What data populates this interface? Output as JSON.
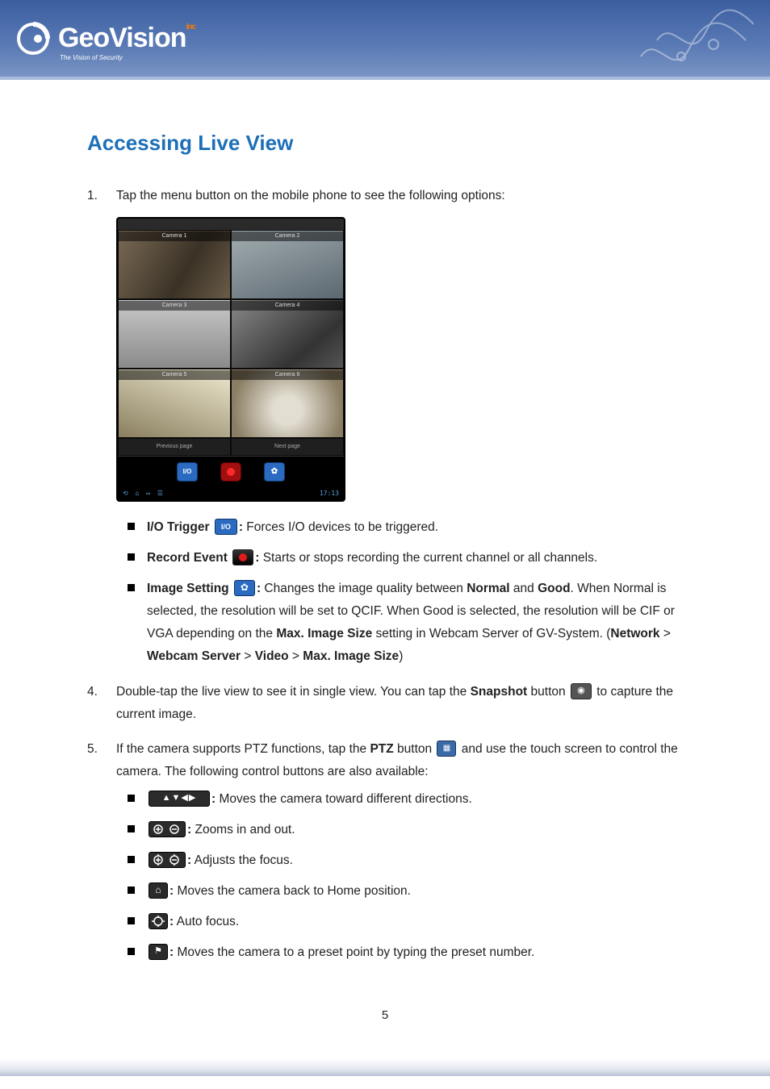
{
  "header": {
    "brand": "GeoVision",
    "brand_suffix": "inc",
    "tagline": "The Vision of Security"
  },
  "title": "Accessing Live View",
  "step1": {
    "num": "1.",
    "text": "Tap the menu button on the mobile phone to see the following options:",
    "screenshot": {
      "title_bar": "",
      "cam_labels": [
        "Camera 1",
        "Camera 2",
        "Camera 3",
        "Camera 4",
        "Camera 5",
        "Camera 6"
      ],
      "nav_prev": "Previous page",
      "nav_next": "Next page",
      "toolbar": {
        "io": "I/O",
        "rec": "",
        "gear": "✿"
      },
      "status_time": "17:13"
    },
    "bullets": {
      "io": {
        "label": "I/O Trigger",
        "icon_text": "I/O",
        "desc": " Forces I/O devices to be triggered."
      },
      "record": {
        "label": "Record Event",
        "desc": " Starts or stops recording the current channel or all channels."
      },
      "image": {
        "label": "Image Setting",
        "desc_a": " Changes the image quality between ",
        "normal": "Normal",
        "and": " and ",
        "good": "Good",
        "desc_b": ". When Normal is selected, the resolution will be set to QCIF. When Good is selected, the resolution will be CIF or VGA depending on the ",
        "max_img": "Max. Image Size",
        "desc_c": " setting in Webcam Server of GV-System. (",
        "path_a": "Network",
        "gt1": " > ",
        "path_b": "Webcam Server",
        "gt2": " > ",
        "path_c": "Video",
        "gt3": " > ",
        "path_d": "Max. Image Size",
        "close": ")"
      }
    }
  },
  "step4": {
    "num": "4.",
    "text_a": "Double-tap the live view to see it in single view. You can tap the ",
    "snapshot": "Snapshot",
    "text_b": " button ",
    "text_c": " to capture the current image."
  },
  "step5": {
    "num": "5.",
    "text_a": "If the camera supports PTZ functions, tap the ",
    "ptz": "PTZ",
    "text_b": " button ",
    "text_c": " and use the touch screen to control the camera. The following control buttons are also available:",
    "bullets": {
      "arrows": " Moves the camera toward different directions.",
      "zoom": " Zooms in and out.",
      "focus": " Adjusts the focus.",
      "home": " Moves the camera back to Home position.",
      "autofocus": " Auto focus.",
      "preset": " Moves the camera to a preset point by typing the preset number."
    }
  },
  "page_number": "5"
}
